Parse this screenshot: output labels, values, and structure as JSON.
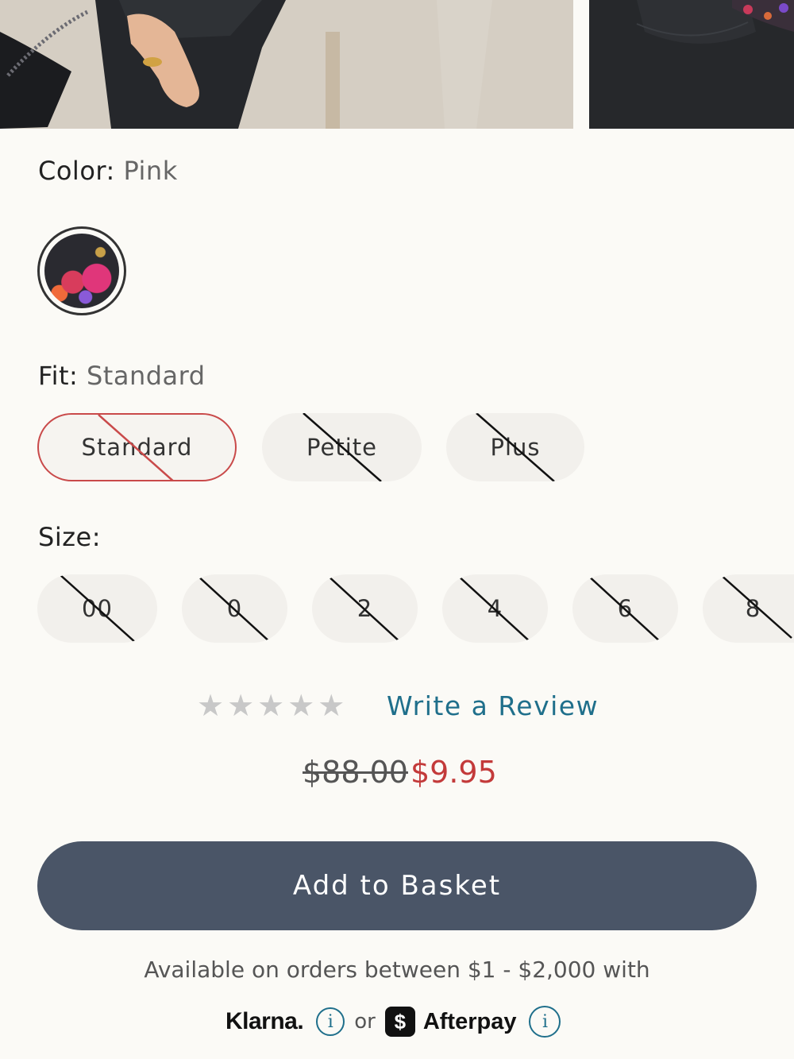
{
  "color": {
    "label": "Color:",
    "value": "Pink"
  },
  "fit": {
    "label": "Fit:",
    "value": "Standard",
    "options": [
      "Standard",
      "Petite",
      "Plus"
    ]
  },
  "size": {
    "label": "Size:",
    "options": [
      "00",
      "0",
      "2",
      "4",
      "6",
      "8"
    ]
  },
  "review": {
    "stars": "★★★★★",
    "link_text": "Write a Review"
  },
  "price": {
    "original": "$88.00",
    "sale": "$9.95"
  },
  "add_button": "Add to Basket",
  "payment": {
    "availability": "Available on orders between $1 - $2,000 with",
    "klarna": "Klarna.",
    "or": "or",
    "afterpay_badge": "$",
    "afterpay": "Afterpay",
    "info_glyph": "i"
  },
  "colors": {
    "accent_link": "#1f6f8b",
    "sale": "#c33a3a",
    "button": "#4a5567",
    "selected_border": "#c94a4a"
  }
}
